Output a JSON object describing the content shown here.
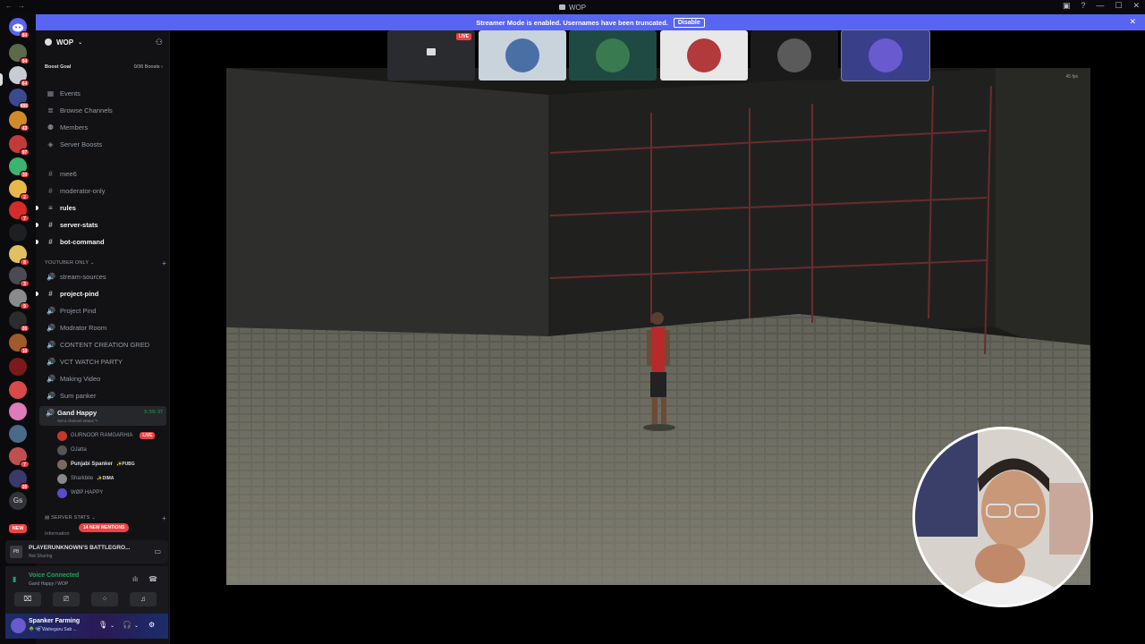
{
  "window": {
    "title": "WOP",
    "controls": [
      "minimize",
      "maximize",
      "close"
    ]
  },
  "banner": {
    "text": "Streamer Mode is enabled. Usernames have been truncated.",
    "button": "Disable",
    "color": "#5865f2"
  },
  "rail": {
    "home_badge": "84",
    "guilds": [
      {
        "badge": "94",
        "color": "#5a6b4a"
      },
      {
        "badge": "64",
        "color": "#c8ccd4"
      },
      {
        "badge": "986",
        "color": "#3b4a8f"
      },
      {
        "badge": "43",
        "color": "#d08a2a"
      },
      {
        "badge": "97",
        "color": "#c23a3a"
      },
      {
        "badge": "30",
        "color": "#3cb371"
      },
      {
        "badge": "2",
        "color": "#e8b84a"
      },
      {
        "badge": "7",
        "color": "#d52b2b"
      },
      {
        "badge": "",
        "color": "#1e1f22"
      },
      {
        "badge": "8",
        "color": "#e0c060"
      },
      {
        "badge": "3",
        "color": "#4a4a52"
      },
      {
        "badge": "9",
        "color": "#8a8a8a"
      },
      {
        "badge": "26",
        "color": "#2b2b30"
      },
      {
        "badge": "10",
        "color": "#a05a2c"
      },
      {
        "badge": "",
        "color": "#7a1a1a"
      },
      {
        "badge": "",
        "color": "#d84a4a"
      },
      {
        "badge": "",
        "color": "#e07ab8"
      },
      {
        "badge": "",
        "color": "#4a6a8a"
      },
      {
        "badge": "7",
        "color": "#c05050"
      },
      {
        "badge": "26",
        "color": "#3a3a6a"
      }
    ],
    "text_guild": "Gs",
    "new_label": "NEW"
  },
  "server": {
    "name": "WOP",
    "boost_label": "Boost Goal",
    "boost_progress": "0/36 Boosts",
    "nav": [
      {
        "icon": "calendar-icon",
        "label": "Events"
      },
      {
        "icon": "browse-icon",
        "label": "Browse Channels"
      },
      {
        "icon": "members-icon",
        "label": "Members"
      },
      {
        "icon": "boost-icon",
        "label": "Server Boosts"
      }
    ],
    "channels_top": [
      {
        "icon": "#",
        "label": "mee6",
        "unread": false
      },
      {
        "icon": "#",
        "label": "moderator-only",
        "unread": false
      },
      {
        "icon": "≡",
        "label": "rules",
        "unread": true
      },
      {
        "icon": "#",
        "label": "server-stats",
        "unread": true
      },
      {
        "icon": "#",
        "label": "bot-command",
        "unread": true
      }
    ],
    "category_youtuber": "YOUTUBER ONLY",
    "channels_youtuber": [
      {
        "icon": "🔊",
        "label": "stream-sources",
        "unread": false
      },
      {
        "icon": "#",
        "label": "project-pind",
        "unread": true
      },
      {
        "icon": "🔊",
        "label": "Project Pind",
        "unread": false
      },
      {
        "icon": "🔊",
        "label": "Modrator Room",
        "unread": false
      },
      {
        "icon": "🔊",
        "label": "CONTENT CREATION GRED",
        "unread": false
      },
      {
        "icon": "🔊",
        "label": "VCT WATCH PARTY",
        "unread": false
      },
      {
        "icon": "🔊",
        "label": "Making Video",
        "unread": false
      },
      {
        "icon": "🔊",
        "label": "Sum panker",
        "unread": false
      }
    ],
    "active_voice": {
      "label": "Gand Happy",
      "status": "Set a channel status ✎",
      "timer": "3:59:37"
    },
    "voice_users": [
      {
        "name": "GURNOOR RAMGARHIA",
        "extra": "LIVE",
        "color": "#c0392b"
      },
      {
        "name": "OJatta",
        "extra": "",
        "color": "#555"
      },
      {
        "name": "Punjabi Spanker",
        "extra": "✨PUBG",
        "color": "#7a6a5a"
      },
      {
        "name": "Sharkbite",
        "extra": "✨DIMA",
        "color": "#888"
      },
      {
        "name": "WØP HAPPY",
        "extra": "",
        "color": "#5a4ad0"
      }
    ],
    "category_stats": "SERVER STATS",
    "mentions": "14 NEW MENTIONS",
    "category_info": "Information"
  },
  "activity": {
    "game_icon": "PB",
    "title": "PLAYERUNKNOWN'S BATTLEGRO...",
    "subtitle": "Not Sharing"
  },
  "voice_connection": {
    "title": "Voice Connected",
    "subtitle": "Gand Happy / WOP"
  },
  "user": {
    "name": "Spanker Farming",
    "status": "🌳 ੴ Waheguru Sab ..."
  },
  "stage": {
    "fps": "45 fps",
    "thumb_live": "LIVE"
  }
}
